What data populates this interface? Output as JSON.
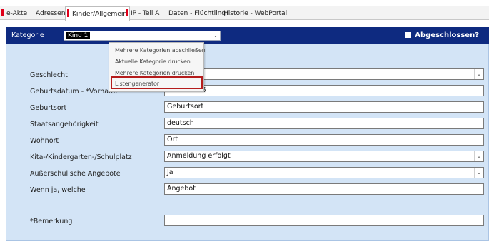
{
  "tabs": [
    {
      "label": "e-Akte",
      "active": false,
      "marker": true
    },
    {
      "label": "Adressen",
      "active": false,
      "marker": false
    },
    {
      "label": "Kinder/Allgemein",
      "active": true,
      "marker": true
    },
    {
      "label": "IP - Teil A",
      "active": false,
      "marker": true
    },
    {
      "label": "Daten - Flüchtling",
      "active": false,
      "marker": false
    },
    {
      "label": "Historie - WebPortal",
      "active": false,
      "marker": false
    }
  ],
  "category": {
    "label": "Kategorie",
    "selected": "Kind 1",
    "closed_label": "Abgeschlossen?"
  },
  "menu": {
    "items": [
      "Mehrere Kategorien abschließen",
      "Aktuelle Kategorie drucken",
      "Mehrere Kategorien drucken",
      "Listengenerator"
    ]
  },
  "form": {
    "geschlecht": {
      "label": "Geschlecht",
      "value": ""
    },
    "geburtsdatum": {
      "label": "Geburtsdatum - *Vorname",
      "value": "29.08.2016"
    },
    "geburtsort": {
      "label": "Geburtsort",
      "value": "Geburtsort"
    },
    "staat": {
      "label": "Staatsangehörigkeit",
      "value": "deutsch"
    },
    "wohnort": {
      "label": "Wohnort",
      "value": "Ort"
    },
    "kita": {
      "label": "Kita-/Kindergarten-/Schulplatz",
      "value": "Anmeldung erfolgt"
    },
    "ausser": {
      "label": "Außerschulische Angebote",
      "value": "Ja"
    },
    "welche": {
      "label": "Wenn ja, welche",
      "value": "Angebot"
    },
    "bemerkung": {
      "label": "*Bemerkung",
      "value": ""
    }
  },
  "colors": {
    "header_bar": "#0e2a80",
    "panel": "#d3e4f6",
    "tab_marker": "#e0001a",
    "highlight": "#b51c1c"
  }
}
